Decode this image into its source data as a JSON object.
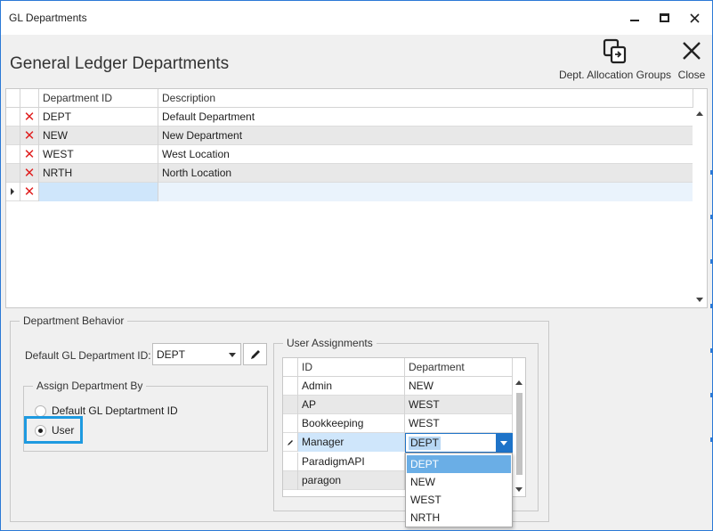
{
  "window": {
    "title": "GL Departments"
  },
  "header": {
    "title": "General Ledger Departments",
    "groups_label": "Dept. Allocation Groups",
    "close_label": "Close"
  },
  "departments_grid": {
    "columns": [
      "Department ID",
      "Description"
    ],
    "rows": [
      {
        "id": "DEPT",
        "desc": "Default Department"
      },
      {
        "id": "NEW",
        "desc": "New Department"
      },
      {
        "id": "WEST",
        "desc": "West Location"
      },
      {
        "id": "NRTH",
        "desc": "North Location"
      },
      {
        "id": "",
        "desc": ""
      }
    ]
  },
  "behavior": {
    "legend": "Department Behavior",
    "default_label": "Default GL Department ID:",
    "default_value": "DEPT",
    "assign_legend": "Assign Department By",
    "option_default": "Default GL Deptartment ID",
    "option_user": "User",
    "selected": "User"
  },
  "user_assignments": {
    "legend": "User Assignments",
    "columns": [
      "ID",
      "Department"
    ],
    "rows": [
      {
        "id": "Admin",
        "dept": "NEW"
      },
      {
        "id": "AP",
        "dept": "WEST"
      },
      {
        "id": "Bookkeeping",
        "dept": "WEST"
      },
      {
        "id": "Manager",
        "dept": "DEPT"
      },
      {
        "id": "ParadigmAPI",
        "dept": ""
      },
      {
        "id": "paragon",
        "dept": ""
      }
    ],
    "dropdown_options": [
      "DEPT",
      "NEW",
      "WEST",
      "NRTH"
    ],
    "dropdown_selected": "DEPT"
  },
  "colors": {
    "accent": "#1e73c8",
    "highlight_box": "#1e9ae0",
    "delete_mark": "#e02020",
    "selection": "#6aaee6"
  }
}
